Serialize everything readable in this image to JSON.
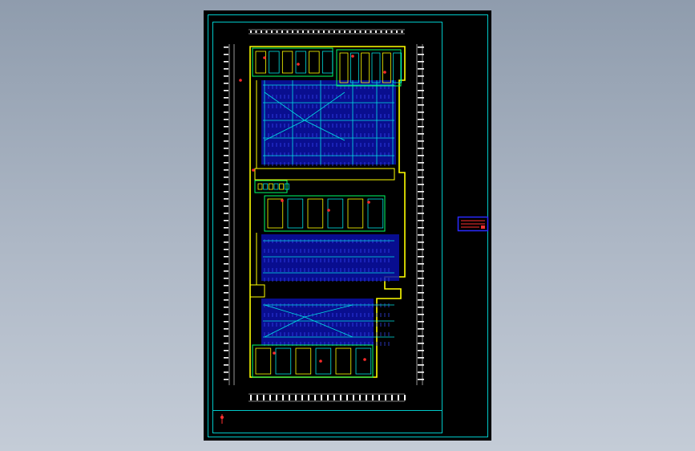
{
  "viewport": {
    "background": "#9aa6b6",
    "drawing_sheet": {
      "background": "#000000",
      "frame_color": "#00c8c8",
      "title_strip_color": "#00c8c8"
    },
    "plan": {
      "outline_color": "#ffff00",
      "parking_color": "#1a2aff",
      "aisle_color": "#00e0e0",
      "wall_color": "#00ff66",
      "accent_color": "#ff2a2a",
      "dimension_color": "#ffffff"
    },
    "legend_block": {
      "border_color": "#2a2aff",
      "text_color": "#ff3030"
    }
  }
}
